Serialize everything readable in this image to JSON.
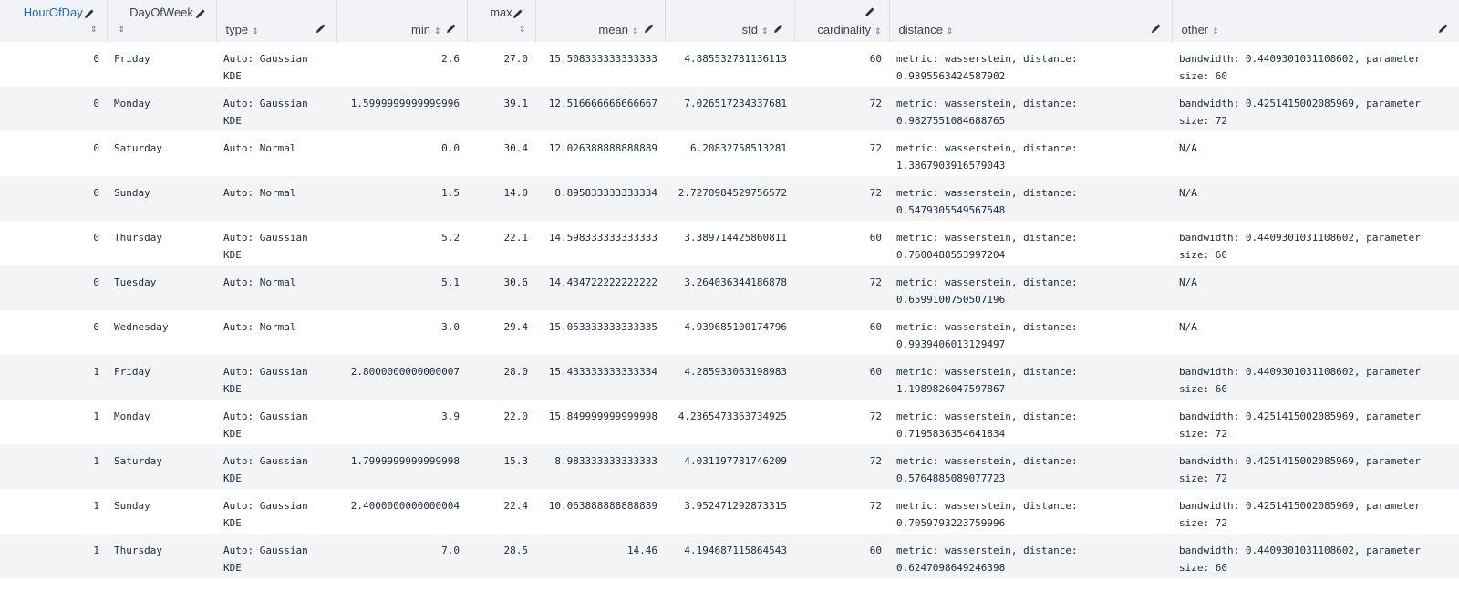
{
  "columns": {
    "HourOfDay": "HourOfDay",
    "DayOfWeek": "DayOfWeek",
    "type": "type",
    "min": "min",
    "max": "max",
    "mean": "mean",
    "std": "std",
    "cardinality": "cardinality",
    "distance": "distance",
    "other": "other"
  },
  "sort_glyph": "⇕",
  "rows": [
    {
      "hour": "0",
      "day": "Friday",
      "type": "Auto: Gaussian KDE",
      "min": "2.6",
      "max": "27.0",
      "mean": "15.508333333333333",
      "std": "4.885532781136113",
      "cardinality": "60",
      "distance": "metric: wasserstein, distance: 0.9395563424587902",
      "other": "bandwidth: 0.4409301031108602, parameter size: 60"
    },
    {
      "hour": "0",
      "day": "Monday",
      "type": "Auto: Gaussian KDE",
      "min": "1.5999999999999996",
      "max": "39.1",
      "mean": "12.516666666666667",
      "std": "7.026517234337681",
      "cardinality": "72",
      "distance": "metric: wasserstein, distance: 0.9827551084688765",
      "other": "bandwidth: 0.4251415002085969, parameter size: 72"
    },
    {
      "hour": "0",
      "day": "Saturday",
      "type": "Auto: Normal",
      "min": "0.0",
      "max": "30.4",
      "mean": "12.026388888888889",
      "std": "6.20832758513281",
      "cardinality": "72",
      "distance": "metric: wasserstein, distance: 1.3867903916579043",
      "other": "N/A"
    },
    {
      "hour": "0",
      "day": "Sunday",
      "type": "Auto: Normal",
      "min": "1.5",
      "max": "14.0",
      "mean": "8.895833333333334",
      "std": "2.7270984529756572",
      "cardinality": "72",
      "distance": "metric: wasserstein, distance: 0.5479305549567548",
      "other": "N/A"
    },
    {
      "hour": "0",
      "day": "Thursday",
      "type": "Auto: Gaussian KDE",
      "min": "5.2",
      "max": "22.1",
      "mean": "14.598333333333333",
      "std": "3.389714425860811",
      "cardinality": "60",
      "distance": "metric: wasserstein, distance: 0.7600488553997204",
      "other": "bandwidth: 0.4409301031108602, parameter size: 60"
    },
    {
      "hour": "0",
      "day": "Tuesday",
      "type": "Auto: Normal",
      "min": "5.1",
      "max": "30.6",
      "mean": "14.434722222222222",
      "std": "3.264036344186878",
      "cardinality": "72",
      "distance": "metric: wasserstein, distance: 0.6599100750507196",
      "other": "N/A"
    },
    {
      "hour": "0",
      "day": "Wednesday",
      "type": "Auto: Normal",
      "min": "3.0",
      "max": "29.4",
      "mean": "15.053333333333335",
      "std": "4.939685100174796",
      "cardinality": "60",
      "distance": "metric: wasserstein, distance: 0.9939406013129497",
      "other": "N/A"
    },
    {
      "hour": "1",
      "day": "Friday",
      "type": "Auto: Gaussian KDE",
      "min": "2.8000000000000007",
      "max": "28.0",
      "mean": "15.433333333333334",
      "std": "4.285933063198983",
      "cardinality": "60",
      "distance": "metric: wasserstein, distance: 1.1989826047597867",
      "other": "bandwidth: 0.4409301031108602, parameter size: 60"
    },
    {
      "hour": "1",
      "day": "Monday",
      "type": "Auto: Gaussian KDE",
      "min": "3.9",
      "max": "22.0",
      "mean": "15.849999999999998",
      "std": "4.2365473363734925",
      "cardinality": "72",
      "distance": "metric: wasserstein, distance: 0.7195836354641834",
      "other": "bandwidth: 0.4251415002085969, parameter size: 72"
    },
    {
      "hour": "1",
      "day": "Saturday",
      "type": "Auto: Gaussian KDE",
      "min": "1.7999999999999998",
      "max": "15.3",
      "mean": "8.983333333333333",
      "std": "4.031197781746209",
      "cardinality": "72",
      "distance": "metric: wasserstein, distance: 0.5764885089077723",
      "other": "bandwidth: 0.4251415002085969, parameter size: 72"
    },
    {
      "hour": "1",
      "day": "Sunday",
      "type": "Auto: Gaussian KDE",
      "min": "2.4000000000000004",
      "max": "22.4",
      "mean": "10.063888888888889",
      "std": "3.952471292873315",
      "cardinality": "72",
      "distance": "metric: wasserstein, distance: 0.7059793223759996",
      "other": "bandwidth: 0.4251415002085969, parameter size: 72"
    },
    {
      "hour": "1",
      "day": "Thursday",
      "type": "Auto: Gaussian KDE",
      "min": "7.0",
      "max": "28.5",
      "mean": "14.46",
      "std": "4.194687115864543",
      "cardinality": "60",
      "distance": "metric: wasserstein, distance: 0.6247098649246398",
      "other": "bandwidth: 0.4409301031108602, parameter size: 60"
    }
  ]
}
